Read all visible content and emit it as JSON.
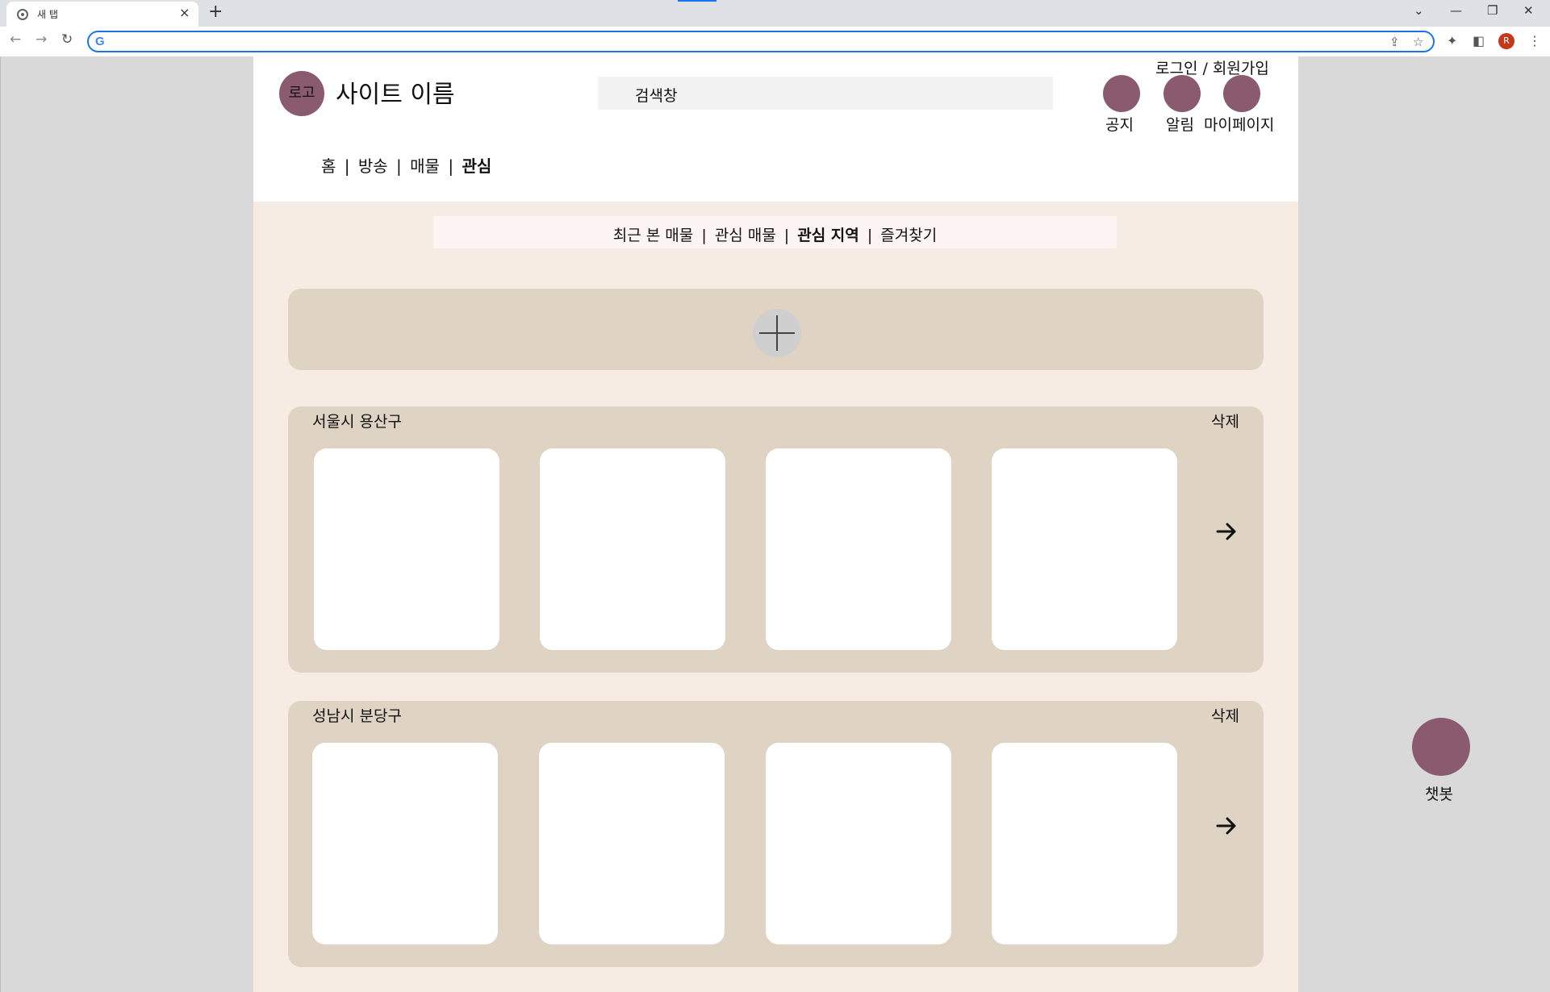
{
  "browser": {
    "tab_title": "새 탭",
    "tab_close": "×",
    "new_tab": "+",
    "address_value": "",
    "profile_initial": "R",
    "icons": [
      "chrome-favicon",
      "back-icon",
      "forward-icon",
      "reload-icon",
      "google-icon",
      "share-icon",
      "star-icon",
      "extensions-icon",
      "sidepanel-icon",
      "menu-icon"
    ]
  },
  "header": {
    "logo": "로고",
    "site_name": "사이트 이름",
    "search_placeholder": "검색창",
    "login_signup": "로그인 / 회원가입",
    "icons": [
      {
        "label": "공지"
      },
      {
        "label": "알림"
      },
      {
        "label": "마이페이지"
      }
    ],
    "nav": [
      "홈",
      "방송",
      "매물",
      "관심"
    ],
    "nav_active": "관심",
    "separator": "|"
  },
  "subnav": {
    "items": [
      "최근 본 매물",
      "관심 매물",
      "관심 지역",
      "즐겨찾기"
    ],
    "active": "관심 지역"
  },
  "regions": [
    {
      "name": "서울시 용산구",
      "delete_label": "삭제"
    },
    {
      "name": "성남시 분당구",
      "delete_label": "삭제"
    }
  ],
  "chatbot": {
    "label": "챗봇"
  },
  "colors": {
    "accent": "#8a5a6e",
    "page_bg": "#f7ece3",
    "panel_bg": "#dfd3c4",
    "subnav_bg": "#fcf5f3",
    "search_bg": "#f2f2f2"
  }
}
